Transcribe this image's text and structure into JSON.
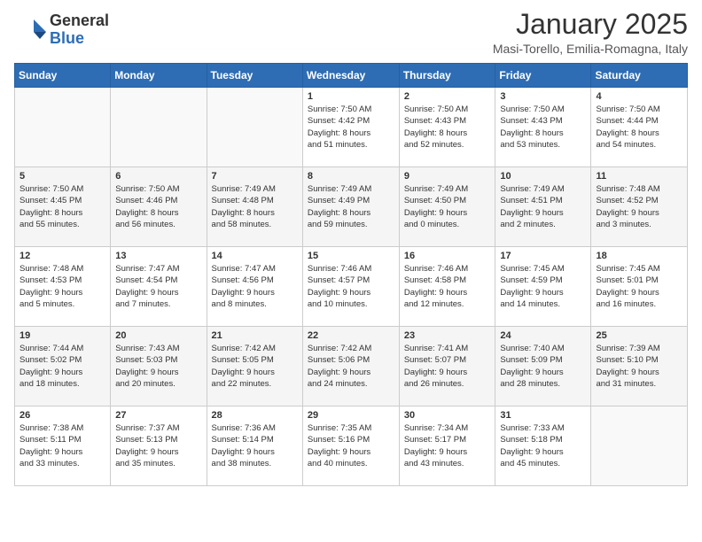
{
  "logo": {
    "general": "General",
    "blue": "Blue"
  },
  "title": "January 2025",
  "subtitle": "Masi-Torello, Emilia-Romagna, Italy",
  "weekdays": [
    "Sunday",
    "Monday",
    "Tuesday",
    "Wednesday",
    "Thursday",
    "Friday",
    "Saturday"
  ],
  "weeks": [
    [
      {
        "day": "",
        "info": ""
      },
      {
        "day": "",
        "info": ""
      },
      {
        "day": "",
        "info": ""
      },
      {
        "day": "1",
        "info": "Sunrise: 7:50 AM\nSunset: 4:42 PM\nDaylight: 8 hours\nand 51 minutes."
      },
      {
        "day": "2",
        "info": "Sunrise: 7:50 AM\nSunset: 4:43 PM\nDaylight: 8 hours\nand 52 minutes."
      },
      {
        "day": "3",
        "info": "Sunrise: 7:50 AM\nSunset: 4:43 PM\nDaylight: 8 hours\nand 53 minutes."
      },
      {
        "day": "4",
        "info": "Sunrise: 7:50 AM\nSunset: 4:44 PM\nDaylight: 8 hours\nand 54 minutes."
      }
    ],
    [
      {
        "day": "5",
        "info": "Sunrise: 7:50 AM\nSunset: 4:45 PM\nDaylight: 8 hours\nand 55 minutes."
      },
      {
        "day": "6",
        "info": "Sunrise: 7:50 AM\nSunset: 4:46 PM\nDaylight: 8 hours\nand 56 minutes."
      },
      {
        "day": "7",
        "info": "Sunrise: 7:49 AM\nSunset: 4:48 PM\nDaylight: 8 hours\nand 58 minutes."
      },
      {
        "day": "8",
        "info": "Sunrise: 7:49 AM\nSunset: 4:49 PM\nDaylight: 8 hours\nand 59 minutes."
      },
      {
        "day": "9",
        "info": "Sunrise: 7:49 AM\nSunset: 4:50 PM\nDaylight: 9 hours\nand 0 minutes."
      },
      {
        "day": "10",
        "info": "Sunrise: 7:49 AM\nSunset: 4:51 PM\nDaylight: 9 hours\nand 2 minutes."
      },
      {
        "day": "11",
        "info": "Sunrise: 7:48 AM\nSunset: 4:52 PM\nDaylight: 9 hours\nand 3 minutes."
      }
    ],
    [
      {
        "day": "12",
        "info": "Sunrise: 7:48 AM\nSunset: 4:53 PM\nDaylight: 9 hours\nand 5 minutes."
      },
      {
        "day": "13",
        "info": "Sunrise: 7:47 AM\nSunset: 4:54 PM\nDaylight: 9 hours\nand 7 minutes."
      },
      {
        "day": "14",
        "info": "Sunrise: 7:47 AM\nSunset: 4:56 PM\nDaylight: 9 hours\nand 8 minutes."
      },
      {
        "day": "15",
        "info": "Sunrise: 7:46 AM\nSunset: 4:57 PM\nDaylight: 9 hours\nand 10 minutes."
      },
      {
        "day": "16",
        "info": "Sunrise: 7:46 AM\nSunset: 4:58 PM\nDaylight: 9 hours\nand 12 minutes."
      },
      {
        "day": "17",
        "info": "Sunrise: 7:45 AM\nSunset: 4:59 PM\nDaylight: 9 hours\nand 14 minutes."
      },
      {
        "day": "18",
        "info": "Sunrise: 7:45 AM\nSunset: 5:01 PM\nDaylight: 9 hours\nand 16 minutes."
      }
    ],
    [
      {
        "day": "19",
        "info": "Sunrise: 7:44 AM\nSunset: 5:02 PM\nDaylight: 9 hours\nand 18 minutes."
      },
      {
        "day": "20",
        "info": "Sunrise: 7:43 AM\nSunset: 5:03 PM\nDaylight: 9 hours\nand 20 minutes."
      },
      {
        "day": "21",
        "info": "Sunrise: 7:42 AM\nSunset: 5:05 PM\nDaylight: 9 hours\nand 22 minutes."
      },
      {
        "day": "22",
        "info": "Sunrise: 7:42 AM\nSunset: 5:06 PM\nDaylight: 9 hours\nand 24 minutes."
      },
      {
        "day": "23",
        "info": "Sunrise: 7:41 AM\nSunset: 5:07 PM\nDaylight: 9 hours\nand 26 minutes."
      },
      {
        "day": "24",
        "info": "Sunrise: 7:40 AM\nSunset: 5:09 PM\nDaylight: 9 hours\nand 28 minutes."
      },
      {
        "day": "25",
        "info": "Sunrise: 7:39 AM\nSunset: 5:10 PM\nDaylight: 9 hours\nand 31 minutes."
      }
    ],
    [
      {
        "day": "26",
        "info": "Sunrise: 7:38 AM\nSunset: 5:11 PM\nDaylight: 9 hours\nand 33 minutes."
      },
      {
        "day": "27",
        "info": "Sunrise: 7:37 AM\nSunset: 5:13 PM\nDaylight: 9 hours\nand 35 minutes."
      },
      {
        "day": "28",
        "info": "Sunrise: 7:36 AM\nSunset: 5:14 PM\nDaylight: 9 hours\nand 38 minutes."
      },
      {
        "day": "29",
        "info": "Sunrise: 7:35 AM\nSunset: 5:16 PM\nDaylight: 9 hours\nand 40 minutes."
      },
      {
        "day": "30",
        "info": "Sunrise: 7:34 AM\nSunset: 5:17 PM\nDaylight: 9 hours\nand 43 minutes."
      },
      {
        "day": "31",
        "info": "Sunrise: 7:33 AM\nSunset: 5:18 PM\nDaylight: 9 hours\nand 45 minutes."
      },
      {
        "day": "",
        "info": ""
      }
    ]
  ]
}
